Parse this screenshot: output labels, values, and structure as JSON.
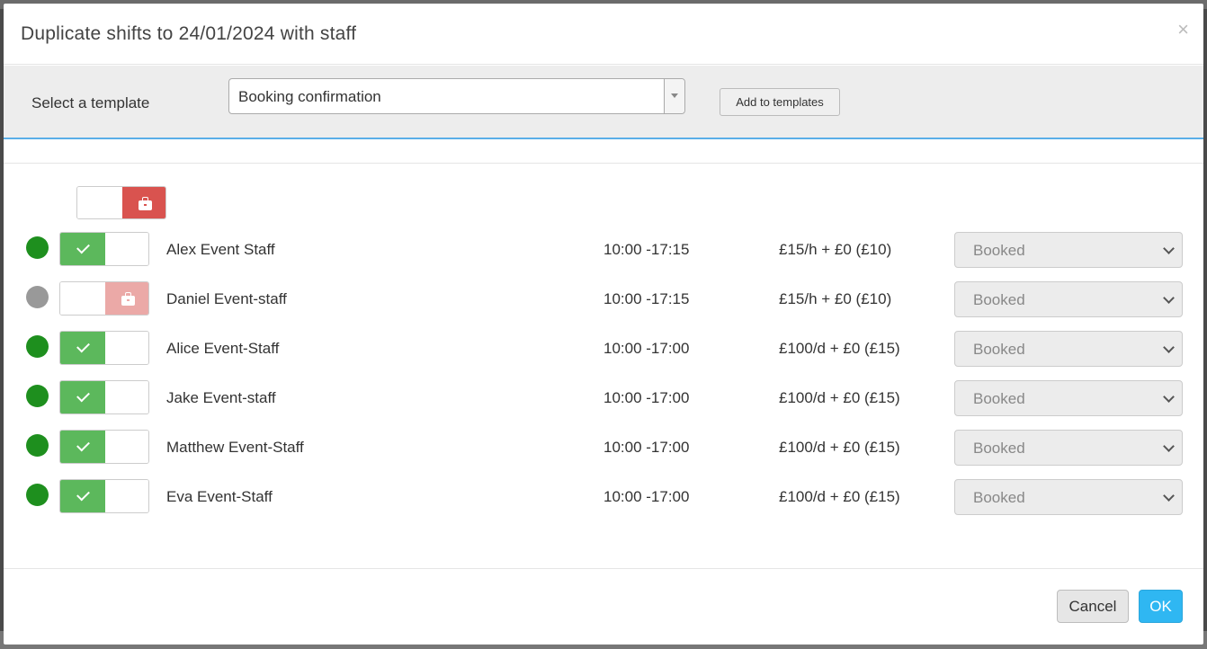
{
  "modal": {
    "title": "Duplicate shifts to 24/01/2024 with staff",
    "close_label": "×"
  },
  "template_bar": {
    "label": "Select a template",
    "selected_template": "Booking confirmation",
    "add_button": "Add to templates"
  },
  "staff": [
    {
      "name": "Alex Event Staff",
      "time": "10:00 -17:15",
      "rate": "£15/h + £0 (£10)",
      "status": "Booked",
      "active": true,
      "dot_color": "#1e8f1e"
    },
    {
      "name": "Daniel Event-staff",
      "time": "10:00 -17:15",
      "rate": "£15/h + £0 (£10)",
      "status": "Booked",
      "active": false,
      "dot_color": "#999999"
    },
    {
      "name": "Alice Event-Staff",
      "time": "10:00 -17:00",
      "rate": "£100/d + £0 (£15)",
      "status": "Booked",
      "active": true,
      "dot_color": "#1e8f1e"
    },
    {
      "name": "Jake Event-staff",
      "time": "10:00 -17:00",
      "rate": "£100/d + £0 (£15)",
      "status": "Booked",
      "active": true,
      "dot_color": "#1e8f1e"
    },
    {
      "name": "Matthew Event-Staff",
      "time": "10:00 -17:00",
      "rate": "£100/d + £0 (£15)",
      "status": "Booked",
      "active": true,
      "dot_color": "#1e8f1e"
    },
    {
      "name": "Eva Event-Staff",
      "time": "10:00 -17:00",
      "rate": "£100/d + £0 (£15)",
      "status": "Booked",
      "active": true,
      "dot_color": "#1e8f1e"
    }
  ],
  "footer": {
    "cancel": "Cancel",
    "ok": "OK"
  },
  "colors": {
    "accent": "#2fb7f2",
    "toggle_on": "#5cb85c",
    "toggle_off": "#d9534f"
  }
}
